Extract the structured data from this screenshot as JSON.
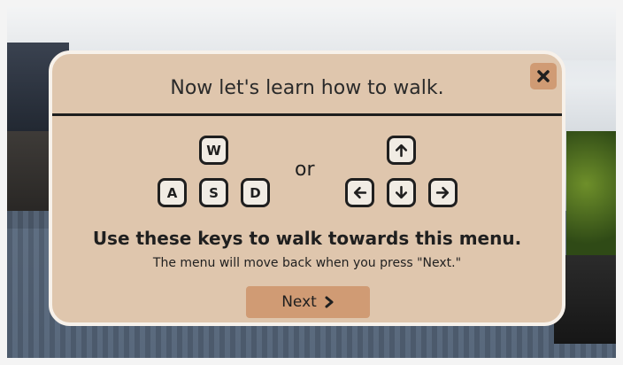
{
  "dialog": {
    "title": "Now let's learn how to walk.",
    "close_icon": "x-icon",
    "wasd_keys": {
      "w": "W",
      "a": "A",
      "s": "S",
      "d": "D"
    },
    "or_text": "or",
    "arrow_keys": {
      "up_icon": "arrow-up-icon",
      "left_icon": "arrow-left-icon",
      "down_icon": "arrow-down-icon",
      "right_icon": "arrow-right-icon"
    },
    "headline": "Use these keys to walk towards this menu.",
    "subline": "The menu will move back when you press \"Next.\"",
    "next_button": {
      "label": "Next",
      "icon": "chevron-right-icon"
    }
  },
  "colors": {
    "panel": "#dfc6ad",
    "panel_border": "#f7f1ea",
    "button": "#d09b74",
    "key_face": "#f1ece4",
    "ink": "#1f1f1f"
  }
}
